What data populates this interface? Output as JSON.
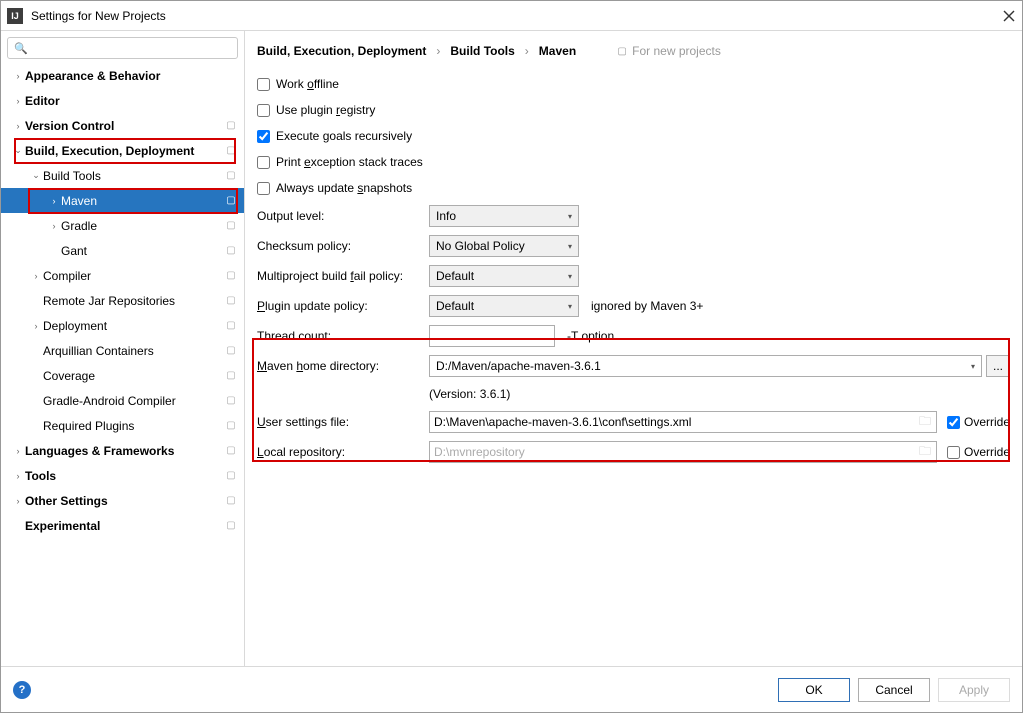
{
  "window": {
    "title": "Settings for New Projects"
  },
  "search": {
    "placeholder": ""
  },
  "sidebar": {
    "items": [
      {
        "label": "Appearance & Behavior",
        "arrow": "›",
        "bold": true,
        "lvl": 0,
        "stack": false
      },
      {
        "label": "Editor",
        "arrow": "›",
        "bold": true,
        "lvl": 0,
        "stack": false
      },
      {
        "label": "Version Control",
        "arrow": "›",
        "bold": true,
        "lvl": 0,
        "stack": true
      },
      {
        "label": "Build, Execution, Deployment",
        "arrow": "⌄",
        "bold": true,
        "lvl": 0,
        "stack": true
      },
      {
        "label": "Build Tools",
        "arrow": "⌄",
        "bold": false,
        "lvl": 1,
        "stack": true
      },
      {
        "label": "Maven",
        "arrow": "›",
        "bold": false,
        "lvl": 2,
        "stack": true,
        "selected": true
      },
      {
        "label": "Gradle",
        "arrow": "›",
        "bold": false,
        "lvl": 2,
        "stack": true
      },
      {
        "label": "Gant",
        "arrow": "",
        "bold": false,
        "lvl": 2,
        "stack": true
      },
      {
        "label": "Compiler",
        "arrow": "›",
        "bold": false,
        "lvl": 1,
        "stack": true
      },
      {
        "label": "Remote Jar Repositories",
        "arrow": "",
        "bold": false,
        "lvl": 1,
        "stack": true
      },
      {
        "label": "Deployment",
        "arrow": "›",
        "bold": false,
        "lvl": 1,
        "stack": true
      },
      {
        "label": "Arquillian Containers",
        "arrow": "",
        "bold": false,
        "lvl": 1,
        "stack": true
      },
      {
        "label": "Coverage",
        "arrow": "",
        "bold": false,
        "lvl": 1,
        "stack": true
      },
      {
        "label": "Gradle-Android Compiler",
        "arrow": "",
        "bold": false,
        "lvl": 1,
        "stack": true
      },
      {
        "label": "Required Plugins",
        "arrow": "",
        "bold": false,
        "lvl": 1,
        "stack": true
      },
      {
        "label": "Languages & Frameworks",
        "arrow": "›",
        "bold": true,
        "lvl": 0,
        "stack": true
      },
      {
        "label": "Tools",
        "arrow": "›",
        "bold": true,
        "lvl": 0,
        "stack": true
      },
      {
        "label": "Other Settings",
        "arrow": "›",
        "bold": true,
        "lvl": 0,
        "stack": true
      },
      {
        "label": "Experimental",
        "arrow": "",
        "bold": true,
        "lvl": 0,
        "stack": true
      }
    ]
  },
  "breadcrumb": {
    "c1": "Build, Execution, Deployment",
    "c2": "Build Tools",
    "c3": "Maven",
    "note": "For new projects"
  },
  "checks": {
    "offline": "Work offline",
    "plugin_registry": "Use plugin registry",
    "recursive": "Execute goals recursively",
    "stack_traces": "Print exception stack traces",
    "snapshots": "Always update snapshots"
  },
  "fields": {
    "output_level": {
      "label": "Output level:",
      "value": "Info"
    },
    "checksum": {
      "label": "Checksum policy:",
      "value": "No Global Policy"
    },
    "fail_policy": {
      "label": "Multiproject build fail policy:",
      "value": "Default"
    },
    "plugin_update": {
      "label": "Plugin update policy:",
      "value": "Default",
      "hint": "ignored by Maven 3+"
    },
    "thread_count": {
      "label": "Thread count:",
      "value": "",
      "hint": "-T option"
    },
    "home_dir": {
      "label": "Maven home directory:",
      "value": "D:/Maven/apache-maven-3.6.1"
    },
    "version": "(Version: 3.6.1)",
    "user_settings": {
      "label": "User settings file:",
      "value": "D:\\Maven\\apache-maven-3.6.1\\conf\\settings.xml",
      "override": "Override",
      "checked": true
    },
    "local_repo": {
      "label": "Local repository:",
      "value": "D:\\mvnrepository",
      "override": "Override",
      "checked": false
    }
  },
  "footer": {
    "ok": "OK",
    "cancel": "Cancel",
    "apply": "Apply"
  },
  "colors": {
    "selection": "#2675bf",
    "highlight": "#d30000"
  }
}
